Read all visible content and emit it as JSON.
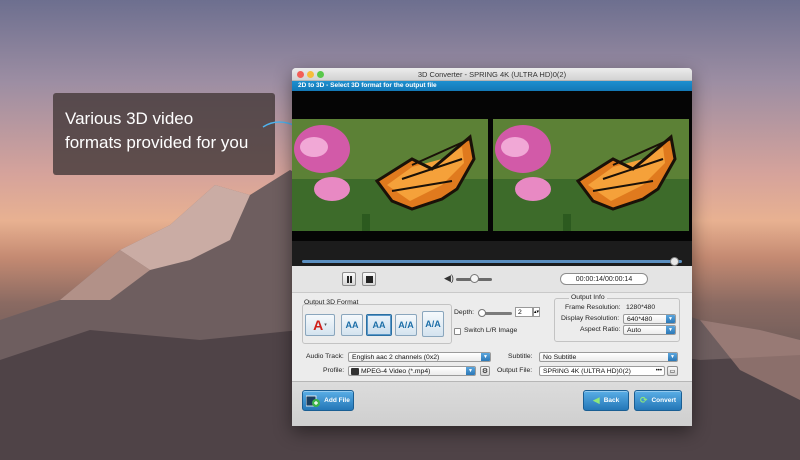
{
  "caption": {
    "line1": "Various 3D video",
    "line2": "formats provided for you"
  },
  "window": {
    "title": "3D Converter - SPRING 4K (ULTRA HD)0(2)",
    "subtitle": "2D to 3D - Select 3D format for the output file"
  },
  "player": {
    "time": "00:00:14/00:00:14",
    "seek_progress": 0.98,
    "volume_level": 0.5
  },
  "format_section": {
    "title": "Output 3D Format",
    "buttons": [
      {
        "label": "A",
        "name": "anaglyph"
      },
      {
        "label": "AA",
        "name": "side-by-side-half"
      },
      {
        "label": "AA",
        "name": "side-by-side-full",
        "selected": true
      },
      {
        "label": "A/A",
        "name": "top-bottom-half"
      },
      {
        "label": "A/A",
        "name": "top-bottom-full"
      }
    ],
    "depth_label": "Depth:",
    "depth_value": "2",
    "switch_label": "Switch L/R Image"
  },
  "output_info": {
    "title": "Output Info",
    "frame_resolution_label": "Frame Resolution:",
    "frame_resolution_value": "1280*480",
    "display_resolution_label": "Display Resolution:",
    "display_resolution_value": "640*480",
    "aspect_ratio_label": "Aspect Ratio:",
    "aspect_ratio_value": "Auto"
  },
  "settings": {
    "audio_track_label": "Audio Track:",
    "audio_track_value": "English aac 2 channels (0x2)",
    "subtitle_label": "Subtitle:",
    "subtitle_value": "No Subtitle",
    "profile_label": "Profile:",
    "profile_value": "MPEG-4 Video (*.mp4)",
    "output_file_label": "Output File:",
    "output_file_value": "SPRING 4K (ULTRA HD)0(2)"
  },
  "bottom": {
    "add_file": "Add File",
    "back": "Back",
    "convert": "Convert"
  }
}
